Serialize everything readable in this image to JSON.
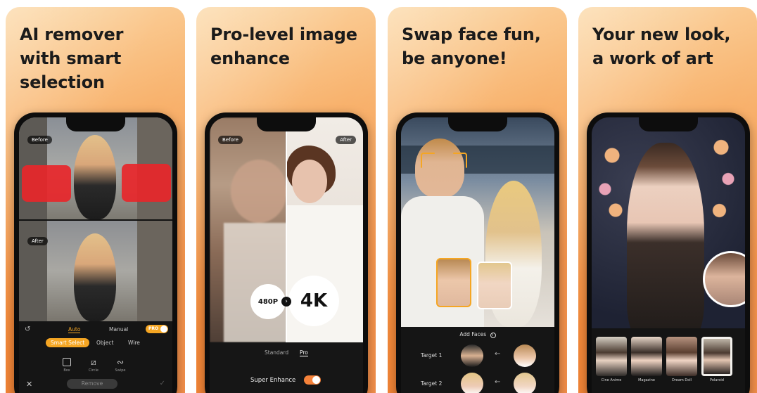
{
  "panels": [
    {
      "headline": "AI remover\nwith smart\nselection",
      "before_label": "Before",
      "after_label": "After",
      "modes": [
        "Auto",
        "Manual"
      ],
      "pro_toggle": "PRO",
      "tools_row": [
        "Smart Select",
        "Object",
        "Wire"
      ],
      "shape_tools": [
        "Box",
        "Circle",
        "Swipe"
      ],
      "remove_label": "Remove"
    },
    {
      "headline": "Pro-level image\nenhance",
      "before_label": "Before",
      "after_label": "After",
      "from_res": "480P",
      "to_res": "4K",
      "tabs": [
        "Standard",
        "Pro"
      ],
      "toggle_label": "Super Enhance"
    },
    {
      "headline": "Swap face fun,\nbe anyone!",
      "add_faces_label": "Add Faces",
      "targets": [
        "Target 1",
        "Target 2"
      ]
    },
    {
      "headline": "Your new look,\na work of art",
      "styles": [
        "Cine Anime",
        "Magazine",
        "Dream Doll",
        "Polaroid"
      ]
    }
  ],
  "colors": {
    "accent_orange": "#f5a623",
    "highlight_red": "#e8262a",
    "panel_gradient_end": "#ef7a2a"
  }
}
